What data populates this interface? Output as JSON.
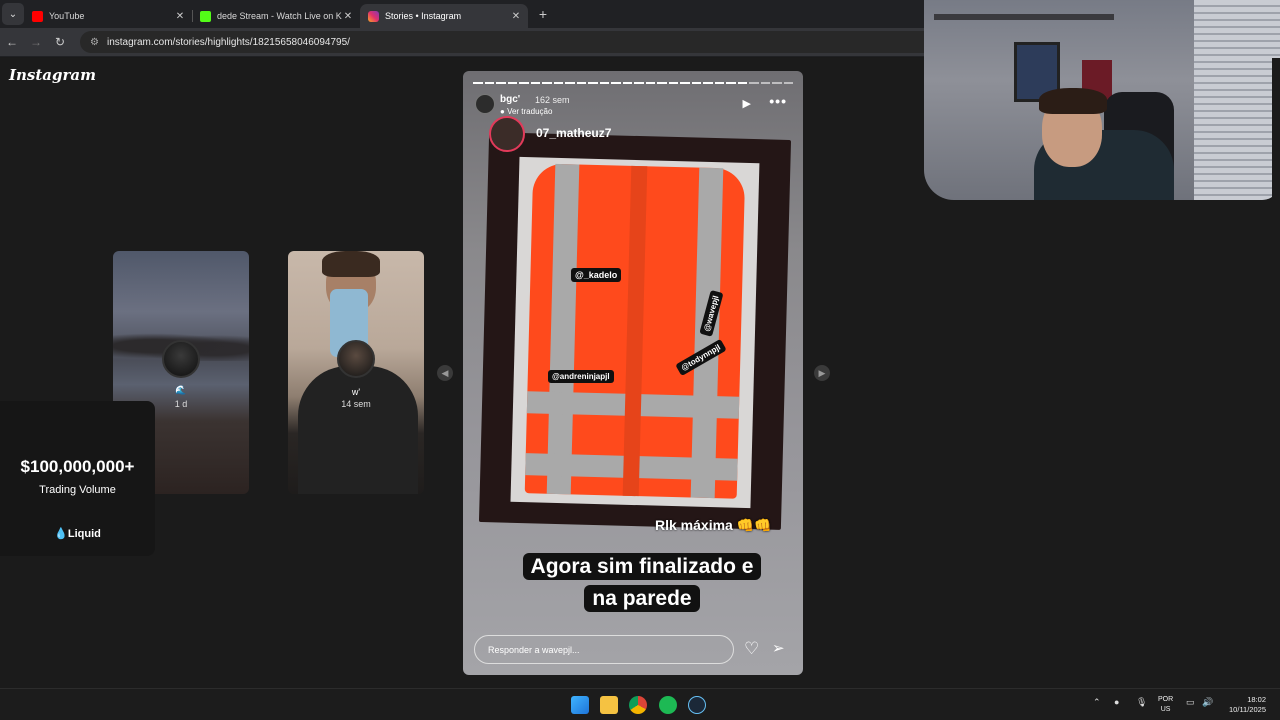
{
  "browser": {
    "tabs": [
      {
        "title": "YouTube",
        "color": "#ff0000",
        "active": false
      },
      {
        "title": "dede Stream - Watch Live on Ki",
        "color": "#53fc18",
        "active": false
      },
      {
        "title": "Stories • Instagram",
        "color": "#e1306c",
        "active": true
      }
    ],
    "new_tab": "+",
    "url": "instagram.com/stories/highlights/18215658046094795/"
  },
  "instagram": {
    "logo": "Instagram",
    "side_stories": [
      {
        "name": "🌊",
        "time": "1 d"
      },
      {
        "name": "w'",
        "time": "14 sem"
      }
    ],
    "ad": {
      "headline": "$100,000,000+",
      "subline": "Trading Volume",
      "brand": "💧Liquid"
    },
    "story": {
      "username": "bgc'",
      "time": "162 sem",
      "translate": "Ver tradução",
      "mention": "07_matheuz7",
      "tags": [
        "@_kadelo",
        "@andreninjapjl",
        "@todynnpjl",
        "@wavepjl"
      ],
      "sticker_text": "Rlk máxima 👊👊",
      "caption_line1": "Agora sim finalizado e",
      "caption_line2": "na parede",
      "reply_placeholder": "Responder a wavepjl..."
    }
  },
  "taskbar": {
    "language": "POR",
    "layout": "US",
    "time": "18:02",
    "date": "10/11/2025"
  }
}
